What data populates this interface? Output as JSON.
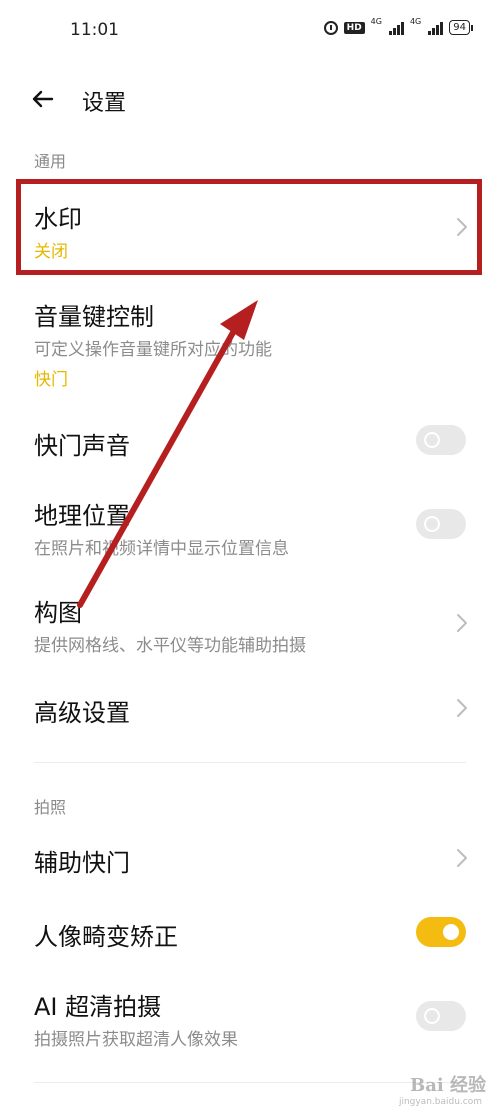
{
  "status_bar": {
    "time": "11:01",
    "hd": "HD",
    "signal1": "4G",
    "signal2": "4G",
    "battery": "94"
  },
  "header": {
    "title": "设置"
  },
  "sections": {
    "general": "通用",
    "photo": "拍照"
  },
  "rows": {
    "watermark": {
      "title": "水印",
      "value": "关闭"
    },
    "volume_key": {
      "title": "音量键控制",
      "subtitle": "可定义操作音量键所对应的功能",
      "value": "快门"
    },
    "shutter_sound": {
      "title": "快门声音",
      "toggle_on": false
    },
    "location": {
      "title": "地理位置",
      "subtitle": "在照片和视频详情中显示位置信息",
      "toggle_on": false
    },
    "composition": {
      "title": "构图",
      "subtitle": "提供网格线、水平仪等功能辅助拍摄"
    },
    "advanced": {
      "title": "高级设置"
    },
    "assist_shutter": {
      "title": "辅助快门"
    },
    "portrait_distortion": {
      "title": "人像畸变矫正",
      "toggle_on": true
    },
    "ai_hd": {
      "title": "AI 超清拍摄",
      "subtitle": "拍摄照片获取超清人像效果",
      "toggle_on": false
    }
  },
  "watermark_overlay": {
    "text": "Bai 经验",
    "sub": "jingyan.baidu.com"
  },
  "colors": {
    "accent": "#f4bc10",
    "annotation": "#b51f1f",
    "value_yellow": "#e6b800"
  }
}
